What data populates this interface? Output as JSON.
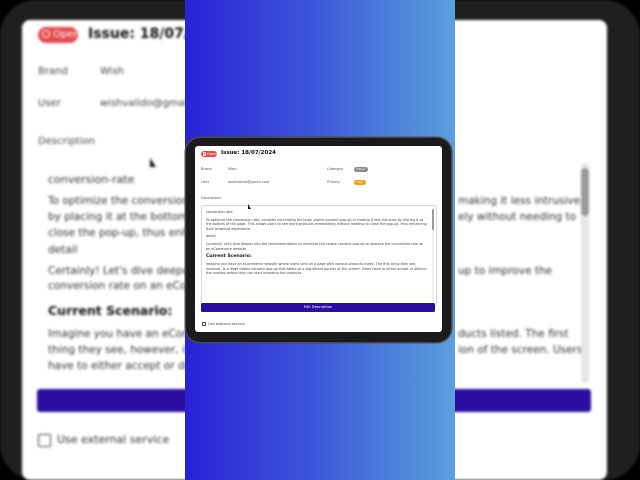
{
  "issue": {
    "status": "Open",
    "title": "Issue: 18/07/2024"
  },
  "fields": {
    "brand_label": "Brand",
    "brand_value": "Wish",
    "user_label": "User",
    "user_value": "wishvalido@gmail.com",
    "category_label": "Category",
    "category_value": "Other",
    "priority_label": "Priority",
    "priority_value": "High",
    "description_label": "Description"
  },
  "description": {
    "p1": "conversion-rate",
    "p2": "To optimize the conversion rate, consider minimizing the large cookie consent pop-up or making it less intrusive by placing it at the bottom of the page. This allows users to see more products immediately without needing to close the pop-up, thus enhancing their browsing experience.",
    "p3": "detail",
    "p4": "Certainly! Let's dive deeper into the recommendation to minimize the cookie consent pop-up to improve the conversion rate on an eCommerce website.",
    "h1": "Current Scenario:",
    "p5": "Imagine you have an eCommerce website where users land on a page with various products listed. The first thing they see, however, is a large cookie consent pop-up that takes up a significant portion of the screen. Users have to either accept or decline the cookies before they can start browsing the products."
  },
  "actions": {
    "edit_label": "Edit Description",
    "external_label": "Use external service"
  },
  "background": {
    "p2_visible": "To optimize the conversion rat",
    "p2_visible_2": "by placing it at the bottom of",
    "p2_visible_3": "close the pop-up, thus enhanc",
    "p2_right_1": "making it less intrusive",
    "p2_right_2": "ely without needing to",
    "p4_left_1": "Certainly! Let's dive deeper in",
    "p4_left_2": "conversion rate on an eComm",
    "p4_right": "up to improve the",
    "h_left": "Current Scenario:",
    "p5_left_1": "Imagine you have an eComme",
    "p5_left_2": "thing they see, however, is a l",
    "p5_left_3": "have to either accept or declin",
    "p5_right_1": "ducts listed. The first",
    "p5_right_2": "ion of the screen. Users",
    "user_partial": "wishvalido@gmail.co"
  },
  "colors": {
    "accent": "#2a0e9f",
    "open_badge": "#e5484d",
    "priority_high": "#f59e0b",
    "category": "#8a8a8a"
  }
}
